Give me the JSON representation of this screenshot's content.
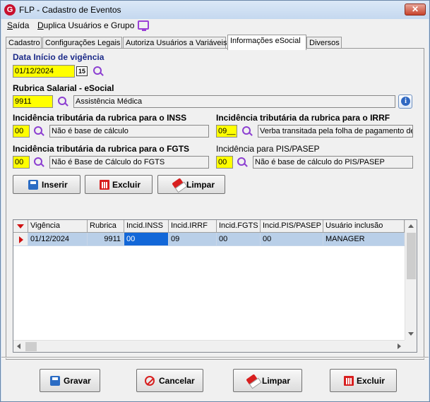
{
  "window": {
    "title": "FLP - Cadastro de Eventos",
    "app_icon": "G",
    "close_glyph": "✕"
  },
  "menu": {
    "saida": {
      "first": "S",
      "rest": "aída"
    },
    "duplica": {
      "first": "D",
      "rest": "uplica Usuários e Grupo"
    }
  },
  "tabs": [
    "Cadastro",
    "Configurações Legais",
    "Autoriza Usuários a Variáveis",
    "Informações eSocial",
    "Diversos"
  ],
  "active_tab": "Informações eSocial",
  "form": {
    "data_inicio": {
      "label": "Data Início de vigência",
      "value": "01/12/2024",
      "cal_glyph": "15"
    },
    "rubrica": {
      "label": "Rubrica Salarial - eSocial",
      "code": "9911",
      "desc": "Assistência Médica"
    },
    "inss": {
      "label": "Incidência tributária da rubrica para o INSS",
      "code": "00",
      "desc": "Não é base de cálculo"
    },
    "irrf": {
      "label": "Incidência tributária da rubrica para o IRRF",
      "code": "09__",
      "desc": "Verba transitada pela folha de pagamento de"
    },
    "fgts": {
      "label": "Incidência tributária da rubrica para o FGTS",
      "code": "00",
      "desc": "Não é Base de Cálculo do FGTS"
    },
    "pis": {
      "label": "Incidência para PIS/PASEP",
      "code": "00",
      "desc": "Não é base de cálculo do PIS/PASEP"
    },
    "info_glyph": "i"
  },
  "grid_buttons": {
    "inserir": "Inserir",
    "excluir": "Excluir",
    "limpar": "Limpar"
  },
  "grid": {
    "columns": [
      "Vigência",
      "Rubrica",
      "Incid.INSS",
      "Incid.IRRF",
      "Incid.FGTS",
      "Incid.PIS/PASEP",
      "Usuário inclusão"
    ],
    "rows": [
      [
        "01/12/2024",
        "9911",
        "00",
        "09",
        "00",
        "00",
        "MANAGER"
      ]
    ]
  },
  "footer_buttons": {
    "gravar": "Gravar",
    "cancelar": "Cancelar",
    "limpar": "Limpar",
    "excluir": "Excluir"
  },
  "colors": {
    "accent_yellow": "#ffff00",
    "selection_blue": "#1267d8",
    "row_blue": "#b9cfe8",
    "label_blue": "#1b2a88",
    "icon_purple": "#8c3fd1",
    "danger_red": "#d81f1f"
  }
}
